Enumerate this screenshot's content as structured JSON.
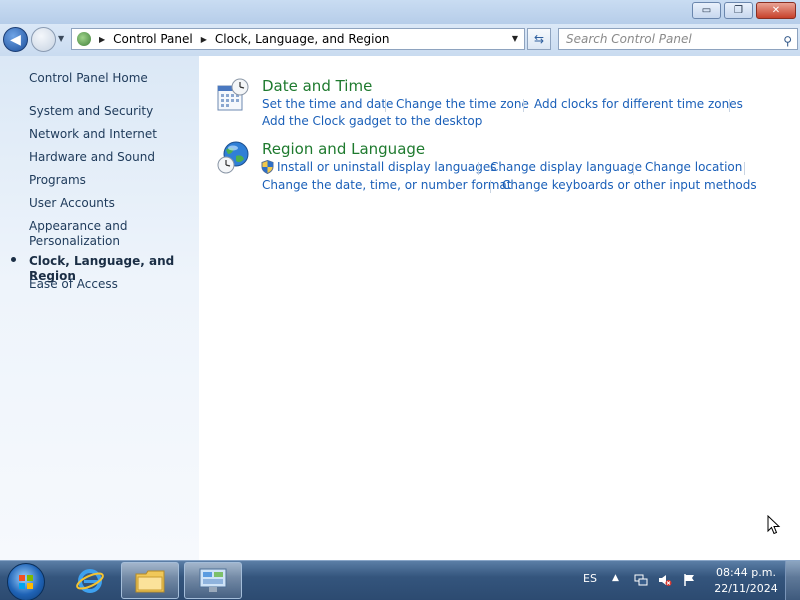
{
  "window": {
    "minimize_glyph": "▭",
    "maximize_glyph": "❐",
    "close_glyph": "✕"
  },
  "nav": {
    "breadcrumb": [
      "Control Panel",
      "Clock, Language, and Region"
    ],
    "search_placeholder": "Search Control Panel"
  },
  "sidebar": {
    "home": "Control Panel Home",
    "items": [
      "System and Security",
      "Network and Internet",
      "Hardware and Sound",
      "Programs",
      "User Accounts",
      "Appearance and",
      "Personalization",
      "Clock, Language, and Region",
      "Ease of Access"
    ],
    "active_item": "Clock, Language, and Region"
  },
  "categories": [
    {
      "title": "Date and Time",
      "icon": "calendar-clock-icon",
      "links": [
        "Set the time and date",
        "Change the time zone",
        "Add clocks for different time zones",
        "Add the Clock gadget to the desktop"
      ]
    },
    {
      "title": "Region and Language",
      "icon": "globe-clock-icon",
      "links": [
        "Install or uninstall display languages",
        "Change display language",
        "Change location",
        "Change the date, time, or number format",
        "Change keyboards or other input methods"
      ]
    }
  ],
  "taskbar": {
    "language": "ES",
    "time": "08:44 p.m.",
    "date": "22/11/2024"
  }
}
